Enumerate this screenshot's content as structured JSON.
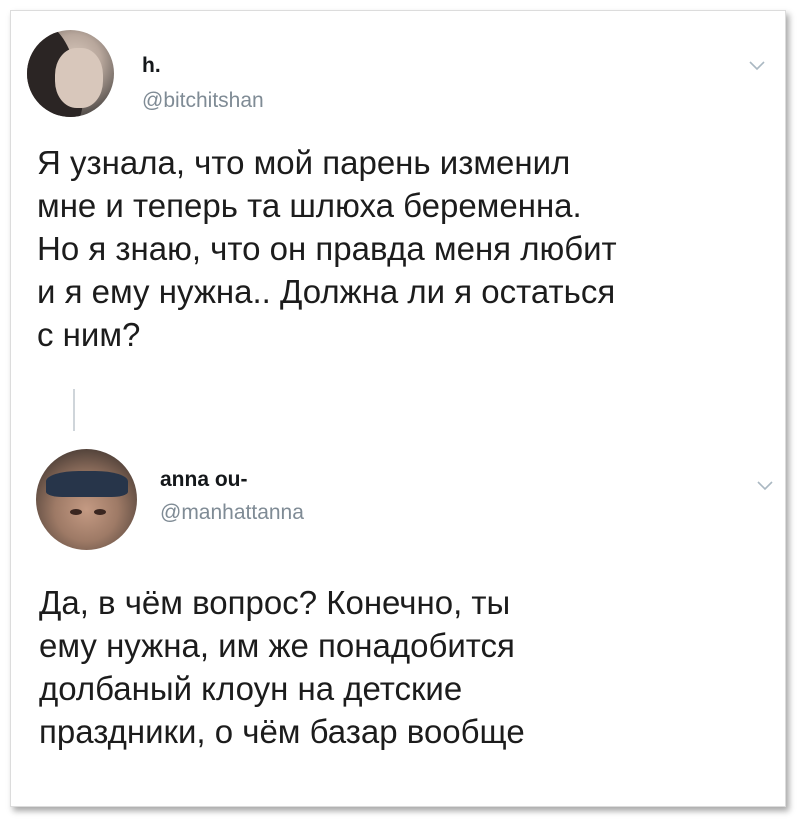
{
  "tweets": [
    {
      "name": "h.",
      "handle": "@bitchitshan",
      "text": "Я узнала, что мой парень изменил\nмне и теперь та шлюха беременна.\nНо я знаю, что он правда меня любит\nи я ему нужна.. Должна ли я остаться\nс ним?"
    },
    {
      "name": "anna ou-",
      "handle": "@manhattanna",
      "text": "Да, в чём вопрос? Конечно, ты\nему нужна, им же понадобится\nдолбаный клоун на детские\nпраздники, о чём базар вообще"
    }
  ],
  "icons": {
    "menu": "chevron-down-icon"
  },
  "colors": {
    "handle": "#7f8b95",
    "text": "#1c1c1c",
    "thread_line": "#cfd5da"
  }
}
